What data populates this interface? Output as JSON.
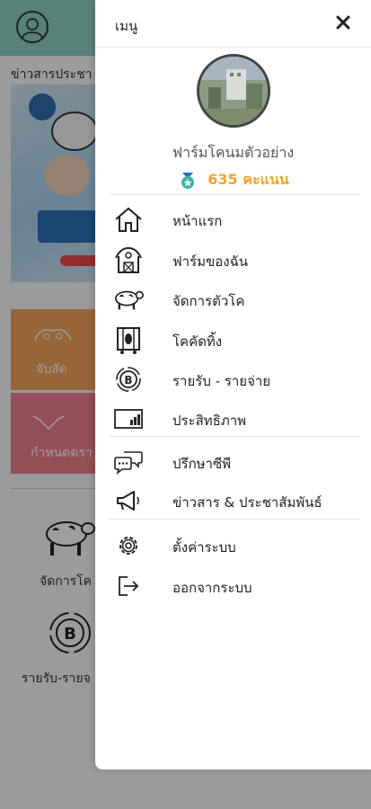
{
  "background": {
    "news_label": "ข่าวสารประชา",
    "tile1_label": "จับสัด",
    "tile2_label": "กำหนดดรา",
    "cow_label": "จัดการโค",
    "finance_label": "รายรับ-รายจ",
    "colors": {
      "header": "#8fd1c1",
      "tile1": "#f3a35b",
      "tile2": "#ef7f8d"
    }
  },
  "drawer": {
    "title": "เมนู",
    "close_icon": "close-icon",
    "farm_name": "ฟาร์มโคนมตัวอย่าง",
    "points": "635 คะแนน",
    "points_color": "#f0a32d",
    "items": [
      {
        "label": "หน้าแรก",
        "icon": "home-icon"
      },
      {
        "label": "ฟาร์มของฉัน",
        "icon": "barn-icon"
      },
      {
        "label": "จัดการตัวโค",
        "icon": "cow-icon"
      },
      {
        "label": "โคคัดทิ้ง",
        "icon": "cull-cow-icon"
      },
      {
        "label": "รายรับ - รายจ่าย",
        "icon": "coin-b-icon"
      },
      {
        "label": "ประสิทธิภาพ",
        "icon": "chart-icon"
      },
      {
        "label": "ปรึกษาซีพี",
        "icon": "chat-icon"
      },
      {
        "label": "ข่าวสาร & ประชาสัมพันธ์",
        "icon": "megaphone-icon"
      },
      {
        "label": "ตั้งค่าระบบ",
        "icon": "gear-icon"
      },
      {
        "label": "ออกจากระบบ",
        "icon": "logout-icon"
      }
    ]
  }
}
